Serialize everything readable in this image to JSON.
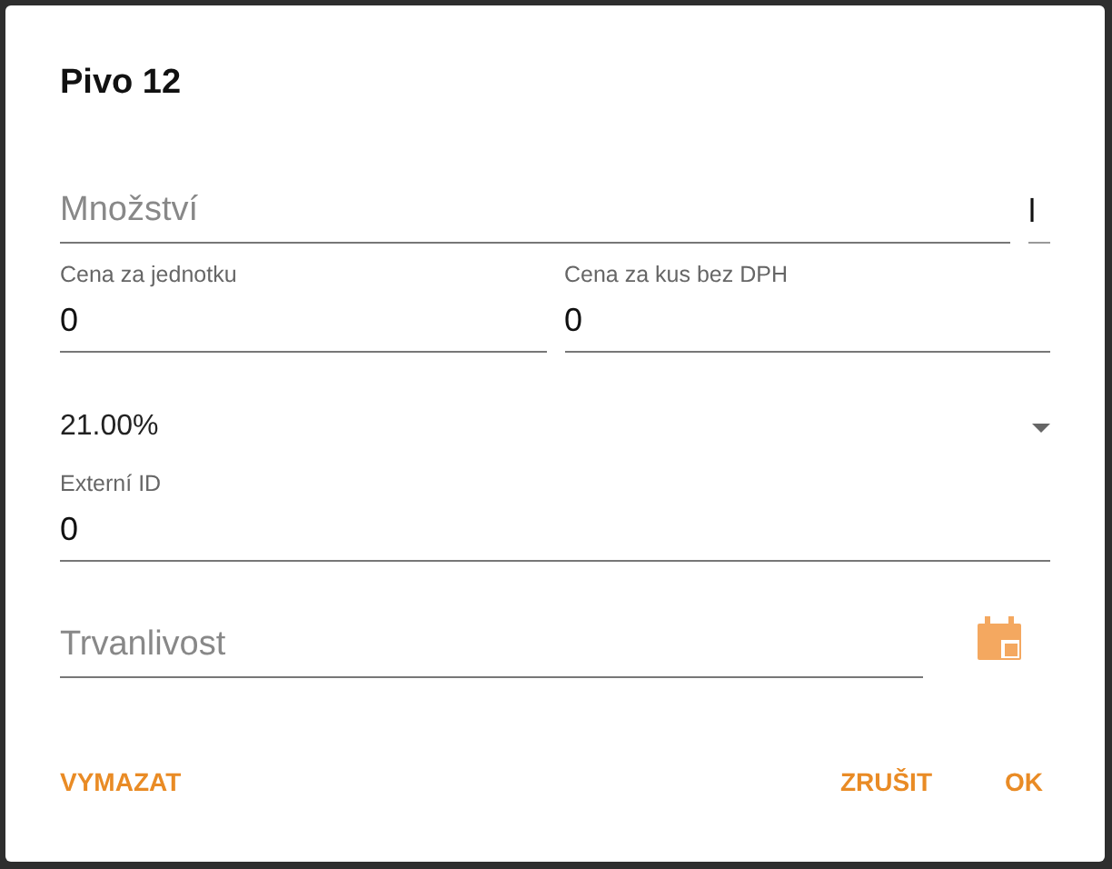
{
  "dialog": {
    "title": "Pivo 12"
  },
  "quantity": {
    "placeholder": "Množství",
    "unit": "l"
  },
  "price_row": [
    {
      "label": "Cena za jednotku",
      "value": "0"
    },
    {
      "label": "Cena za kus bez DPH",
      "value": "0"
    }
  ],
  "vat": {
    "value": "21.00%"
  },
  "external_id": {
    "label": "Externí ID",
    "value": "0"
  },
  "expiry": {
    "placeholder": "Trvanlivost"
  },
  "buttons": [
    {
      "label": "VYMAZAT",
      "kind": "left"
    },
    {
      "label": "ZRUŠIT",
      "kind": "right"
    },
    {
      "label": "OK",
      "kind": "right"
    }
  ]
}
